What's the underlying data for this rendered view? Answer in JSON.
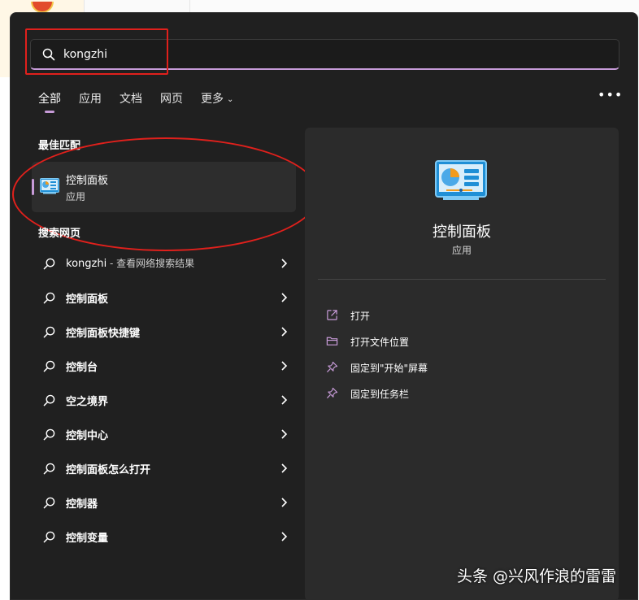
{
  "search": {
    "value": "kongzhi"
  },
  "tabs": [
    {
      "label": "全部"
    },
    {
      "label": "应用"
    },
    {
      "label": "文档"
    },
    {
      "label": "网页"
    },
    {
      "label": "更多"
    }
  ],
  "more_options_icon": "ellipsis-icon",
  "best_match": {
    "title": "最佳匹配",
    "item": {
      "name": "控制面板",
      "kind": "应用",
      "icon": "control-panel-icon"
    }
  },
  "web": {
    "title": "搜索网页",
    "items": [
      {
        "query": "kongzhi",
        "suffix": " - 查看网络搜索结果"
      },
      {
        "query": "控制面板"
      },
      {
        "query": "控制面板快捷键"
      },
      {
        "query": "控制台"
      },
      {
        "query": "空之境界"
      },
      {
        "query": "控制中心"
      },
      {
        "query": "控制面板怎么打开"
      },
      {
        "query": "控制器"
      },
      {
        "query": "控制变量"
      }
    ]
  },
  "detail": {
    "name": "控制面板",
    "kind": "应用",
    "actions": [
      {
        "label": "打开",
        "icon": "open-external-icon"
      },
      {
        "label": "打开文件位置",
        "icon": "folder-icon"
      },
      {
        "label": "固定到\"开始\"屏幕",
        "icon": "pin-icon"
      },
      {
        "label": "固定到任务栏",
        "icon": "pin-icon"
      }
    ]
  },
  "colors": {
    "accent": "#c79bd8",
    "panel": "#202020",
    "pane": "#2b2b2b",
    "annotation": "#e0201c"
  },
  "watermark": "头条 @兴风作浪的雷雷"
}
